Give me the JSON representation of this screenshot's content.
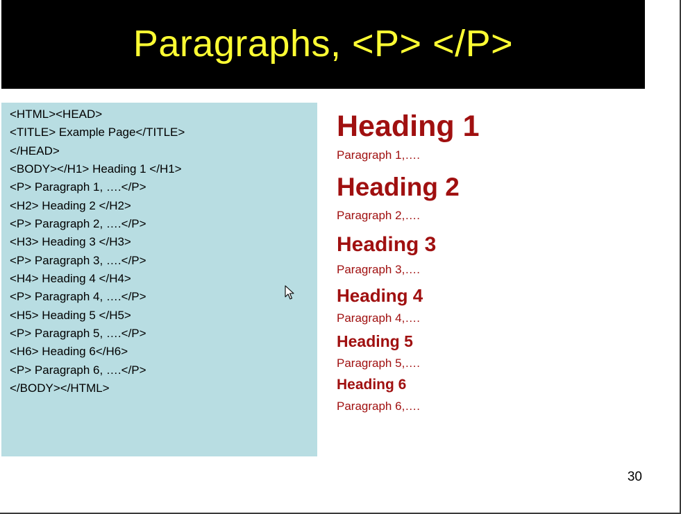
{
  "slide": {
    "title": "Paragraphs, <P> </P>",
    "page_number": "30",
    "colors": {
      "title_bar": "#000000",
      "title_text": "#ffff33",
      "code_panel": "#b8dde2",
      "rendered_text": "#a01010"
    }
  },
  "code": {
    "lines": [
      "<HTML><HEAD>",
      "<TITLE> Example Page</TITLE>",
      "</HEAD>",
      "<BODY></H1> Heading 1 </H1>",
      "<P> Paragraph 1, ….</P>",
      "<H2> Heading 2 </H2>",
      "<P> Paragraph 2, ….</P>",
      "<H3> Heading 3 </H3>",
      "<P> Paragraph 3, ….</P>",
      "<H4> Heading 4 </H4>",
      "<P> Paragraph 4, ….</P>",
      "<H5> Heading 5 </H5>",
      "<P> Paragraph 5, ….</P>",
      "<H6> Heading 6</H6>",
      "<P> Paragraph 6, ….</P>",
      "</BODY></HTML>"
    ]
  },
  "rendered": {
    "h1": "Heading 1",
    "p1": "Paragraph 1,….",
    "h2": "Heading 2",
    "p2": "Paragraph 2,….",
    "h3": "Heading 3",
    "p3": "Paragraph 3,….",
    "h4": "Heading 4",
    "p4": "Paragraph 4,….",
    "h5": "Heading 5",
    "p5": "Paragraph 5,….",
    "h6": "Heading 6",
    "p6": "Paragraph 6,…."
  },
  "cursor": {
    "icon": "mouse-pointer-icon"
  }
}
